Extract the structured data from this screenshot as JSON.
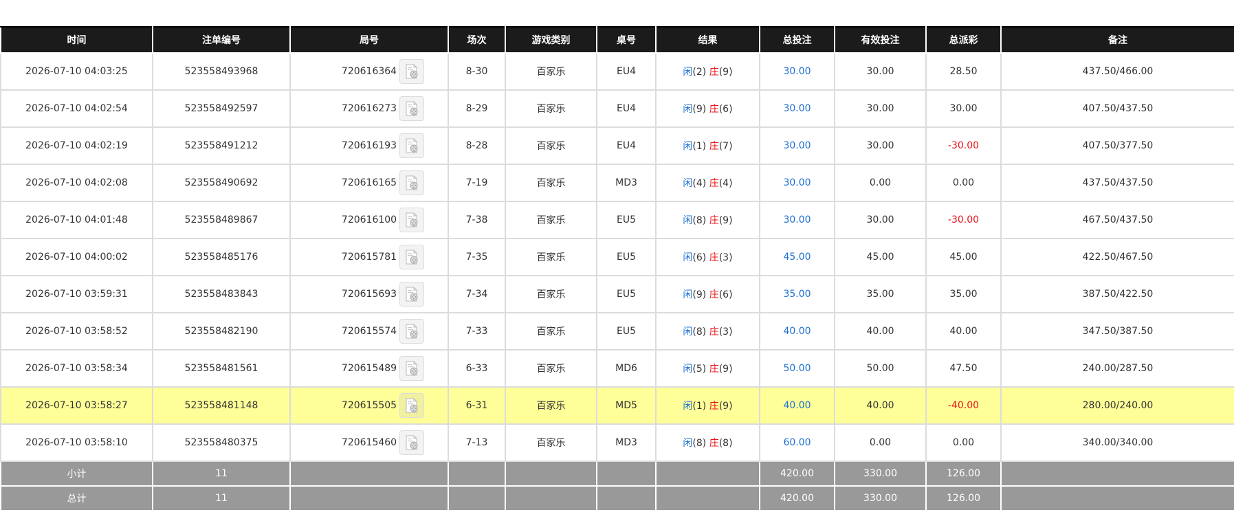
{
  "columns": {
    "time": "时间",
    "bet_no": "注单编号",
    "round_no": "局号",
    "shoe": "场次",
    "game_type": "游戏类别",
    "table": "桌号",
    "result": "结果",
    "total_bet": "总投注",
    "valid_bet": "有效投注",
    "payout": "总派彩",
    "note": "备注"
  },
  "result_labels": {
    "player": "闲",
    "banker": "庄"
  },
  "colors": {
    "header_bg": "#1b1b1b",
    "highlight": "#ffff99",
    "positive_blue": "#1f6fd1",
    "negative_red": "#e8141a",
    "summary_bg": "#999999"
  },
  "rows": [
    {
      "time": "2026-07-10 04:03:25",
      "bet_no": "523558493968",
      "round_no": "720616364",
      "shoe": "8-30",
      "game": "百家乐",
      "table": "EU4",
      "p": "(2)",
      "b": "(9)",
      "total": "30.00",
      "valid": "30.00",
      "payout": "28.50",
      "payout_negative": false,
      "note": "437.50/466.00"
    },
    {
      "time": "2026-07-10 04:02:54",
      "bet_no": "523558492597",
      "round_no": "720616273",
      "shoe": "8-29",
      "game": "百家乐",
      "table": "EU4",
      "p": "(9)",
      "b": "(6)",
      "total": "30.00",
      "valid": "30.00",
      "payout": "30.00",
      "payout_negative": false,
      "note": "407.50/437.50"
    },
    {
      "time": "2026-07-10 04:02:19",
      "bet_no": "523558491212",
      "round_no": "720616193",
      "shoe": "8-28",
      "game": "百家乐",
      "table": "EU4",
      "p": "(1)",
      "b": "(7)",
      "total": "30.00",
      "valid": "30.00",
      "payout": "-30.00",
      "payout_negative": true,
      "note": "407.50/377.50"
    },
    {
      "time": "2026-07-10 04:02:08",
      "bet_no": "523558490692",
      "round_no": "720616165",
      "shoe": "7-19",
      "game": "百家乐",
      "table": "MD3",
      "p": "(4)",
      "b": "(4)",
      "total": "30.00",
      "valid": "0.00",
      "payout": "0.00",
      "payout_negative": false,
      "note": "437.50/437.50"
    },
    {
      "time": "2026-07-10 04:01:48",
      "bet_no": "523558489867",
      "round_no": "720616100",
      "shoe": "7-38",
      "game": "百家乐",
      "table": "EU5",
      "p": "(8)",
      "b": "(9)",
      "total": "30.00",
      "valid": "30.00",
      "payout": "-30.00",
      "payout_negative": true,
      "note": "467.50/437.50"
    },
    {
      "time": "2026-07-10 04:00:02",
      "bet_no": "523558485176",
      "round_no": "720615781",
      "shoe": "7-35",
      "game": "百家乐",
      "table": "EU5",
      "p": "(6)",
      "b": "(3)",
      "total": "45.00",
      "valid": "45.00",
      "payout": "45.00",
      "payout_negative": false,
      "note": "422.50/467.50"
    },
    {
      "time": "2026-07-10 03:59:31",
      "bet_no": "523558483843",
      "round_no": "720615693",
      "shoe": "7-34",
      "game": "百家乐",
      "table": "EU5",
      "p": "(9)",
      "b": "(6)",
      "total": "35.00",
      "valid": "35.00",
      "payout": "35.00",
      "payout_negative": false,
      "note": "387.50/422.50"
    },
    {
      "time": "2026-07-10 03:58:52",
      "bet_no": "523558482190",
      "round_no": "720615574",
      "shoe": "7-33",
      "game": "百家乐",
      "table": "EU5",
      "p": "(8)",
      "b": "(3)",
      "total": "40.00",
      "valid": "40.00",
      "payout": "40.00",
      "payout_negative": false,
      "note": "347.50/387.50"
    },
    {
      "time": "2026-07-10 03:58:34",
      "bet_no": "523558481561",
      "round_no": "720615489",
      "shoe": "6-33",
      "game": "百家乐",
      "table": "MD6",
      "p": "(5)",
      "b": "(9)",
      "total": "50.00",
      "valid": "50.00",
      "payout": "47.50",
      "payout_negative": false,
      "note": "240.00/287.50"
    },
    {
      "time": "2026-07-10 03:58:27",
      "bet_no": "523558481148",
      "round_no": "720615505",
      "shoe": "6-31",
      "game": "百家乐",
      "table": "MD5",
      "p": "(1)",
      "b": "(9)",
      "total": "40.00",
      "valid": "40.00",
      "payout": "-40.00",
      "payout_negative": true,
      "note": "280.00/240.00",
      "highlight": true
    },
    {
      "time": "2026-07-10 03:58:10",
      "bet_no": "523558480375",
      "round_no": "720615460",
      "shoe": "7-13",
      "game": "百家乐",
      "table": "MD3",
      "p": "(8)",
      "b": "(8)",
      "total": "60.00",
      "valid": "0.00",
      "payout": "0.00",
      "payout_negative": false,
      "note": "340.00/340.00"
    }
  ],
  "subtotal": {
    "label": "小计",
    "count": "11",
    "total": "420.00",
    "valid": "330.00",
    "payout": "126.00"
  },
  "grandtotal": {
    "label": "总计",
    "count": "11",
    "total": "420.00",
    "valid": "330.00",
    "payout": "126.00"
  }
}
